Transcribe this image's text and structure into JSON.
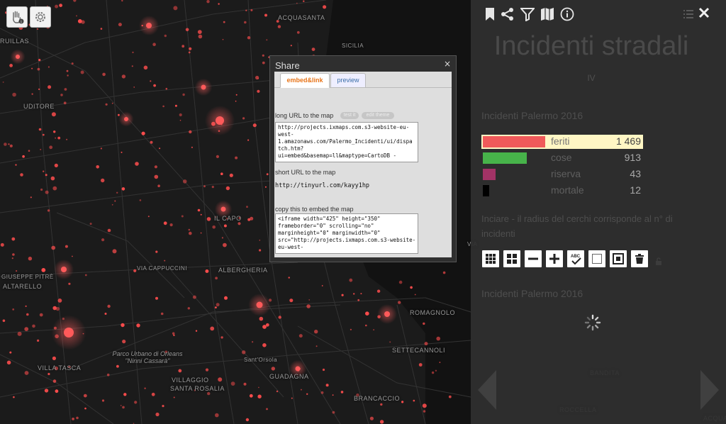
{
  "map": {
    "places": [
      {
        "name": "ACQUASANTA",
        "slot": "a"
      },
      {
        "name": "RUILLAS",
        "slot": "b"
      },
      {
        "name": "UDITORE",
        "slot": "c"
      },
      {
        "name": "IL CAPO",
        "slot": "d"
      },
      {
        "name": "ALBERGHERIA",
        "slot": "e"
      },
      {
        "name": "ALTARELLO",
        "slot": "f"
      },
      {
        "name": "VILLA TASCA",
        "slot": "g"
      },
      {
        "name": "VILLAGGIO",
        "slot": "h"
      },
      {
        "name": "SANTA ROSALIA",
        "slot": "i"
      },
      {
        "name": "GUADAGNA",
        "slot": "j"
      },
      {
        "name": "BRANCACCIO",
        "slot": "k"
      },
      {
        "name": "ROMAGNOLO",
        "slot": "l"
      },
      {
        "name": "SETTECANNOLI",
        "slot": "m"
      },
      {
        "name": "BANDITA",
        "slot": "n"
      },
      {
        "name": "ROCCELLA",
        "slot": "o"
      },
      {
        "name": "ACQUA DEI",
        "slot": "p"
      }
    ],
    "streets": [
      {
        "name": "VIA CAPPUCCINI"
      },
      {
        "name": "GIUSEPPE PITRÈ"
      },
      {
        "name": "Sant'Orsola"
      },
      {
        "name": "SICILIA"
      },
      {
        "name": "VIA"
      }
    ],
    "park": "Parco Urbano di Orleans \"Ninni Cassarà\""
  },
  "tools": {
    "info_mode_icon": "hand-info-icon",
    "settings_icon": "gear-icon"
  },
  "panel": {
    "header_icons": [
      "bookmark-icon",
      "share-icon",
      "filter-icon",
      "map-icon",
      "info-icon"
    ],
    "title": "Incidenti stradali",
    "subtitle": "IV",
    "section_title": "Incidenti Palermo 2016",
    "legend": [
      {
        "label": "feriti",
        "value": "1 469",
        "color": "#f05a5a",
        "share": 1.0
      },
      {
        "label": "cose",
        "value": "913",
        "color": "#47b34a",
        "share": 0.7
      },
      {
        "label": "riserva",
        "value": "43",
        "color": "#a23366",
        "share": 0.2
      },
      {
        "label": "mortale",
        "value": "12",
        "color": "#000000",
        "share": 0.1
      }
    ],
    "note": "Inciare - il radius del cerchi corrisponde al n° di incidenti",
    "section_title_2": "Incidenti Palermo 2016",
    "controls": [
      "grid-small-icon",
      "grid-large-icon",
      "zoom-out-icon",
      "zoom-in-icon",
      "spellcheck-icon",
      "square-icon",
      "target-square-icon",
      "trash-icon"
    ]
  },
  "share": {
    "title": "Share",
    "close": "×",
    "tabs": [
      {
        "label": "embed&link",
        "active": true
      },
      {
        "label": "preview",
        "active": false
      }
    ],
    "long_url_label": "long URL to the map",
    "pill_1": "test it",
    "pill_2": "edit theme",
    "long_url": "http://projects.ixmaps.com.s3-website-eu-\nwest-\n1.amazonaws.com/Palermo_Incidenti/ui/dispa\ntch.htm?\nui=embed&basemap=ll&maptype=CartoDB -",
    "short_url_label": "short URL to the map",
    "short_url": "http://tinyurl.com/kayy1hp",
    "embed_label": "copy this to embed the map",
    "embed_code": "<iframe width=\"425\" height=\"350\"\nframeborder=\"0\" scrolling=\"no\"\nmarginheight=\"0\" marginwidth=\"0\"\nsrc=\"http://projects.ixmaps.com.s3-website-\neu-west-"
  }
}
